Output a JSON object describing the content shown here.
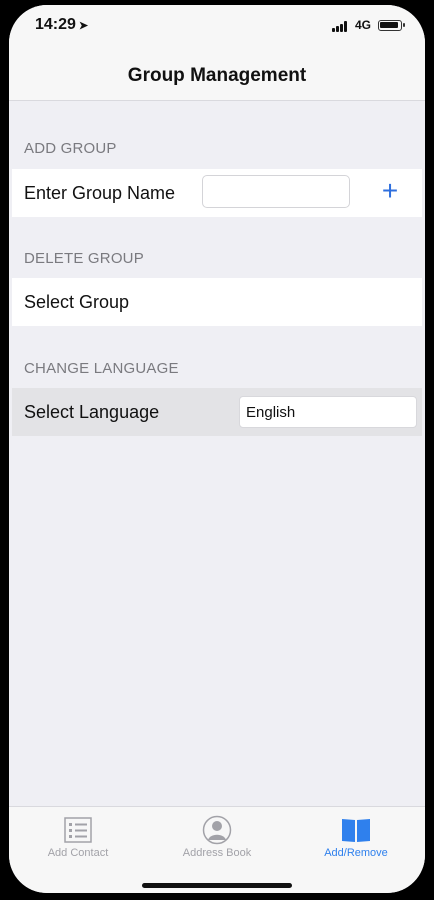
{
  "status_bar": {
    "time": "14:29",
    "network": "4G"
  },
  "nav": {
    "title": "Group Management"
  },
  "sections": {
    "add_group": {
      "header": "ADD GROUP",
      "label": "Enter Group Name",
      "input_value": "",
      "add_symbol": "+"
    },
    "delete_group": {
      "header": "DELETE GROUP",
      "label": "Select Group"
    },
    "change_language": {
      "header": "CHANGE LANGUAGE",
      "label": "Select Language",
      "selected_value": "English"
    }
  },
  "tabbar": {
    "items": [
      {
        "label": "Add Contact",
        "icon": "list-icon",
        "active": false
      },
      {
        "label": "Address Book",
        "icon": "person-icon",
        "active": false
      },
      {
        "label": "Add/Remove",
        "icon": "book-icon",
        "active": true
      }
    ]
  },
  "colors": {
    "accent": "#2f80ed",
    "background": "#efeff4",
    "inactive": "#a2a2a8"
  }
}
